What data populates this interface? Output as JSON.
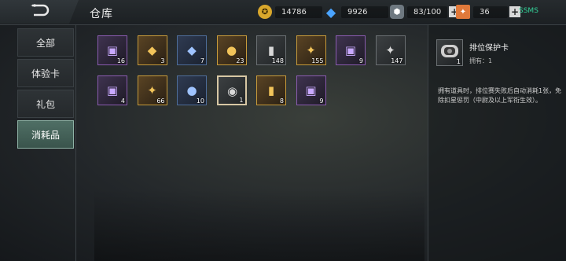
{
  "header": {
    "title": "仓库",
    "back_icon": "back-arrow-icon"
  },
  "resources": [
    {
      "name": "gold",
      "icon": "gold-coin-icon",
      "value": "14786",
      "color": "#d9a72c"
    },
    {
      "name": "diamond",
      "icon": "diamond-icon",
      "value": "9926",
      "color": "#4aa3ff"
    },
    {
      "name": "crystal",
      "icon": "crystal-icon",
      "value": "83/100",
      "color": "#9aa6b2"
    },
    {
      "name": "ticket",
      "icon": "ticket-icon",
      "value": "36",
      "color": "#e0793a"
    }
  ],
  "status": {
    "signal": "SSMS"
  },
  "sidebar": {
    "tabs": [
      {
        "label": "全部",
        "active": false
      },
      {
        "label": "体验卡",
        "active": false
      },
      {
        "label": "礼包",
        "active": false
      },
      {
        "label": "消耗品",
        "active": true
      }
    ]
  },
  "items": [
    {
      "icon": "rank-card-icon",
      "rarity": "purple",
      "count": "16",
      "glyph": "▣"
    },
    {
      "icon": "agreement-diamond-icon",
      "rarity": "gold",
      "count": "3",
      "glyph": "◆"
    },
    {
      "icon": "agreement-diamond-icon",
      "rarity": "blue",
      "count": "7",
      "glyph": "◆"
    },
    {
      "icon": "gold-coin-card-icon",
      "rarity": "gold",
      "count": "23",
      "glyph": "●"
    },
    {
      "icon": "walkie-talkie-icon",
      "rarity": "gray",
      "count": "148",
      "glyph": "▮"
    },
    {
      "icon": "book-icon",
      "rarity": "gold",
      "count": "155",
      "glyph": "✦"
    },
    {
      "icon": "rank-card-icon",
      "rarity": "purple",
      "count": "9",
      "glyph": "▣"
    },
    {
      "icon": "book-icon",
      "rarity": "gray",
      "count": "147",
      "glyph": "✦"
    },
    {
      "icon": "rank-card-icon",
      "rarity": "purple",
      "count": "4",
      "glyph": "▣"
    },
    {
      "icon": "book-icon",
      "rarity": "gold",
      "count": "66",
      "glyph": "✦"
    },
    {
      "icon": "coin-card-icon",
      "rarity": "blue",
      "count": "10",
      "glyph": "●"
    },
    {
      "icon": "rank-protection-card-icon",
      "rarity": "gray",
      "count": "1",
      "glyph": "◉",
      "selected": true
    },
    {
      "icon": "walkie-talkie-icon",
      "rarity": "gold",
      "count": "8",
      "glyph": "▮"
    },
    {
      "icon": "rank-card-icon",
      "rarity": "purple",
      "count": "9",
      "glyph": "▣"
    }
  ],
  "detail": {
    "icon": "rank-protection-card-icon",
    "count": "1",
    "name": "排位保护卡",
    "owned": "拥有：1",
    "description": "拥有道具时，排位赛失败后自动消耗1张，免除扣星惩罚（中尉及以上军衔生效）。"
  }
}
